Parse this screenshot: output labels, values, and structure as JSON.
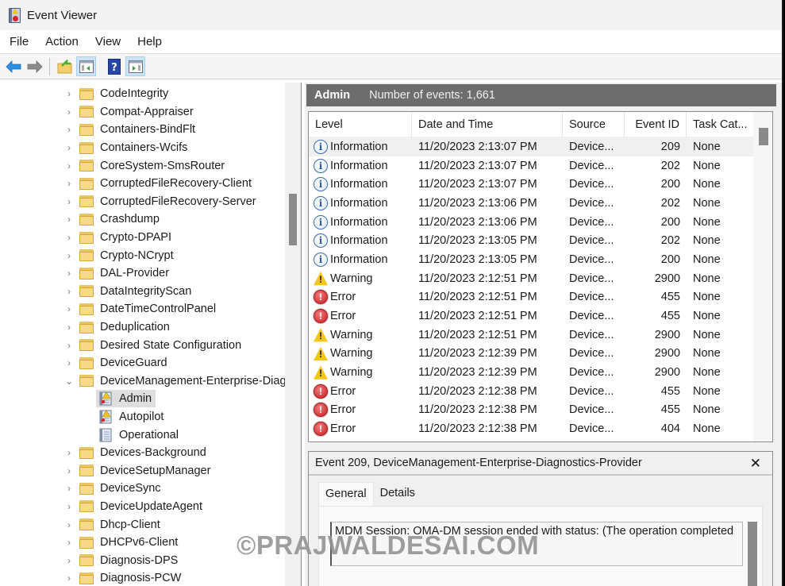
{
  "window": {
    "title": "Event Viewer"
  },
  "menu": {
    "items": [
      "File",
      "Action",
      "View",
      "Help"
    ]
  },
  "toolbar": {
    "buttons": [
      {
        "icon": "back-arrow-icon"
      },
      {
        "icon": "forward-arrow-icon"
      },
      {
        "icon": "open-folder-icon"
      },
      {
        "icon": "show-hide-console-tree-icon"
      },
      {
        "icon": "help-icon"
      },
      {
        "icon": "show-hide-action-pane-icon"
      }
    ]
  },
  "tree": {
    "items": [
      {
        "label": "CodeIntegrity",
        "type": "folder"
      },
      {
        "label": "Compat-Appraiser",
        "type": "folder"
      },
      {
        "label": "Containers-BindFlt",
        "type": "folder"
      },
      {
        "label": "Containers-Wcifs",
        "type": "folder"
      },
      {
        "label": "CoreSystem-SmsRouter",
        "type": "folder"
      },
      {
        "label": "CorruptedFileRecovery-Client",
        "type": "folder"
      },
      {
        "label": "CorruptedFileRecovery-Server",
        "type": "folder"
      },
      {
        "label": "Crashdump",
        "type": "folder"
      },
      {
        "label": "Crypto-DPAPI",
        "type": "folder"
      },
      {
        "label": "Crypto-NCrypt",
        "type": "folder"
      },
      {
        "label": "DAL-Provider",
        "type": "folder"
      },
      {
        "label": "DataIntegrityScan",
        "type": "folder"
      },
      {
        "label": "DateTimeControlPanel",
        "type": "folder"
      },
      {
        "label": "Deduplication",
        "type": "folder"
      },
      {
        "label": "Desired State Configuration",
        "type": "folder"
      },
      {
        "label": "DeviceGuard",
        "type": "folder"
      },
      {
        "label": "DeviceManagement-Enterprise-Diagnostics-Provider",
        "type": "folder",
        "expanded": true
      },
      {
        "label": "Admin",
        "type": "log",
        "selected": true
      },
      {
        "label": "Autopilot",
        "type": "log"
      },
      {
        "label": "Operational",
        "type": "log-plain"
      },
      {
        "label": "Devices-Background",
        "type": "folder"
      },
      {
        "label": "DeviceSetupManager",
        "type": "folder"
      },
      {
        "label": "DeviceSync",
        "type": "folder"
      },
      {
        "label": "DeviceUpdateAgent",
        "type": "folder"
      },
      {
        "label": "Dhcp-Client",
        "type": "folder"
      },
      {
        "label": "DHCPv6-Client",
        "type": "folder"
      },
      {
        "label": "Diagnosis-DPS",
        "type": "folder"
      },
      {
        "label": "Diagnosis-PCW",
        "type": "folder"
      }
    ]
  },
  "pane_header": {
    "name": "Admin",
    "count": "Number of events: 1,661"
  },
  "grid": {
    "columns": [
      "Level",
      "Date and Time",
      "Source",
      "Event ID",
      "Task Cat..."
    ],
    "rows": [
      {
        "level": "Information",
        "date": "11/20/2023 2:13:07 PM",
        "source": "Device...",
        "id": "209",
        "task": "None",
        "selected": true
      },
      {
        "level": "Information",
        "date": "11/20/2023 2:13:07 PM",
        "source": "Device...",
        "id": "202",
        "task": "None"
      },
      {
        "level": "Information",
        "date": "11/20/2023 2:13:07 PM",
        "source": "Device...",
        "id": "200",
        "task": "None"
      },
      {
        "level": "Information",
        "date": "11/20/2023 2:13:06 PM",
        "source": "Device...",
        "id": "202",
        "task": "None"
      },
      {
        "level": "Information",
        "date": "11/20/2023 2:13:06 PM",
        "source": "Device...",
        "id": "200",
        "task": "None"
      },
      {
        "level": "Information",
        "date": "11/20/2023 2:13:05 PM",
        "source": "Device...",
        "id": "202",
        "task": "None"
      },
      {
        "level": "Information",
        "date": "11/20/2023 2:13:05 PM",
        "source": "Device...",
        "id": "200",
        "task": "None"
      },
      {
        "level": "Warning",
        "date": "11/20/2023 2:12:51 PM",
        "source": "Device...",
        "id": "2900",
        "task": "None"
      },
      {
        "level": "Error",
        "date": "11/20/2023 2:12:51 PM",
        "source": "Device...",
        "id": "455",
        "task": "None"
      },
      {
        "level": "Error",
        "date": "11/20/2023 2:12:51 PM",
        "source": "Device...",
        "id": "455",
        "task": "None"
      },
      {
        "level": "Warning",
        "date": "11/20/2023 2:12:51 PM",
        "source": "Device...",
        "id": "2900",
        "task": "None"
      },
      {
        "level": "Warning",
        "date": "11/20/2023 2:12:39 PM",
        "source": "Device...",
        "id": "2900",
        "task": "None"
      },
      {
        "level": "Warning",
        "date": "11/20/2023 2:12:39 PM",
        "source": "Device...",
        "id": "2900",
        "task": "None"
      },
      {
        "level": "Error",
        "date": "11/20/2023 2:12:38 PM",
        "source": "Device...",
        "id": "455",
        "task": "None"
      },
      {
        "level": "Error",
        "date": "11/20/2023 2:12:38 PM",
        "source": "Device...",
        "id": "455",
        "task": "None"
      },
      {
        "level": "Error",
        "date": "11/20/2023 2:12:38 PM",
        "source": "Device...",
        "id": "404",
        "task": "None"
      }
    ]
  },
  "detail": {
    "title": "Event 209, DeviceManagement-Enterprise-Diagnostics-Provider",
    "close_label": "✕",
    "tabs": [
      "General",
      "Details"
    ],
    "active_tab": "General",
    "message": "MDM Session: OMA-DM session ended with status: (The operation completed"
  },
  "watermark": "©PRAJWALDESAI.COM",
  "colors": {
    "header_bg": "#6d6d6d",
    "selection": "#dedede",
    "info": "#3c6fb5",
    "warning": "#f5c518",
    "error": "#c41e24"
  }
}
